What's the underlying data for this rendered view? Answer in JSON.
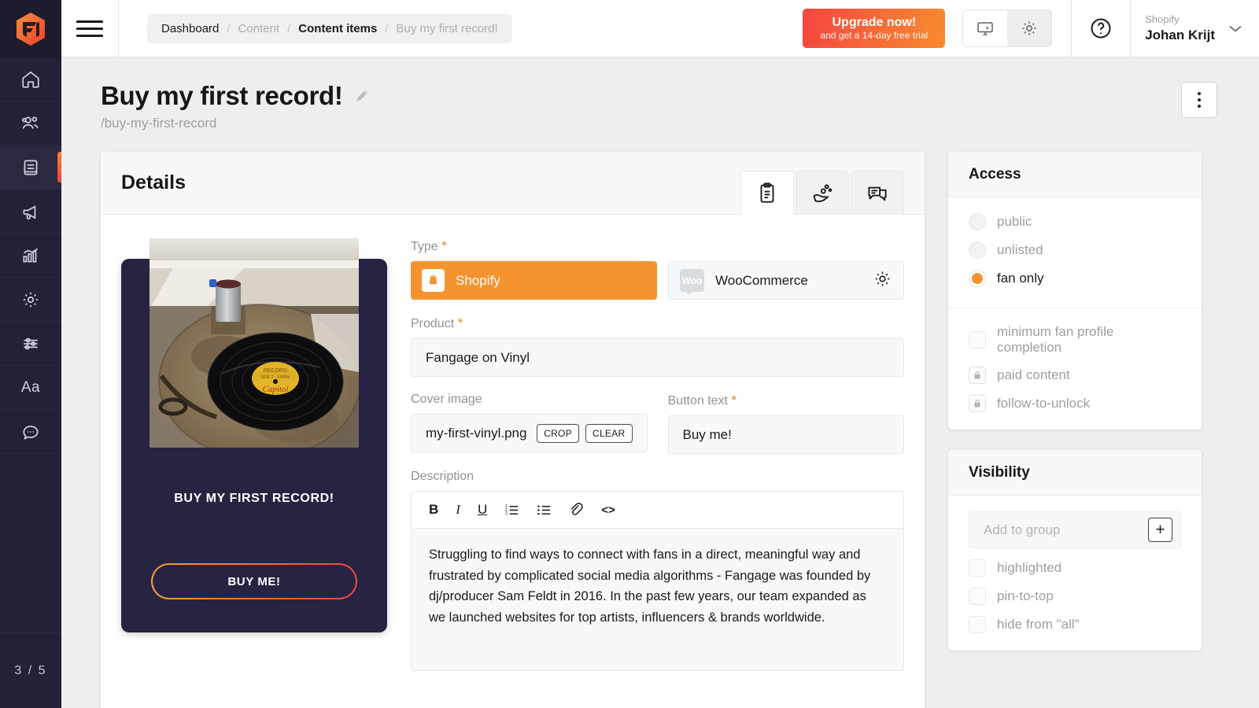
{
  "rail": {
    "logo_icon": "fangage-hex-logo",
    "items": [
      {
        "icon": "home-icon",
        "name": "home"
      },
      {
        "icon": "users-icon",
        "name": "fans"
      },
      {
        "icon": "book-icon",
        "name": "content",
        "active": true
      },
      {
        "icon": "megaphone-icon",
        "name": "campaigns"
      },
      {
        "icon": "bar-chart-icon",
        "name": "analytics"
      },
      {
        "icon": "gear-icon",
        "name": "settings"
      },
      {
        "icon": "sliders-icon",
        "name": "preferences"
      },
      {
        "icon": "typography-icon",
        "name": "typography",
        "glyph": "Aa"
      },
      {
        "icon": "chat-bubble-icon",
        "name": "messages"
      }
    ],
    "page_indicator": "3 / 5"
  },
  "topbar": {
    "menu_icon": "hamburger-icon",
    "breadcrumb": [
      {
        "label": "Dashboard",
        "style": "link"
      },
      {
        "label": "Content",
        "style": "muted"
      },
      {
        "label": "Content items",
        "style": "bold"
      },
      {
        "label": "Buy my first record!",
        "style": "muted"
      }
    ],
    "separator": "/",
    "upgrade": {
      "line1": "Upgrade now!",
      "line2": "and get a 14-day free trial",
      "gradient_from": "#f6473f",
      "gradient_to": "#f78a2e"
    },
    "segment": [
      {
        "icon": "monitor-cursor-icon",
        "active": false
      },
      {
        "icon": "gear-icon",
        "active": true
      }
    ],
    "help_icon": "question-circle-icon",
    "user": {
      "org": "Shopify",
      "name": "Johan Krijt",
      "chevron_icon": "chevron-down-icon"
    }
  },
  "page": {
    "title": "Buy my first record!",
    "edit_icon": "pencil-icon",
    "slug": "/buy-my-first-record",
    "kebab_icon": "more-vertical-icon"
  },
  "details": {
    "title": "Details",
    "tabs": [
      {
        "icon": "clipboard-icon",
        "name": "details-tab",
        "active": true
      },
      {
        "icon": "hand-bubbles-icon",
        "name": "engagement-tab",
        "active": false
      },
      {
        "icon": "speech-bubbles-icon",
        "name": "comments-tab",
        "active": false
      }
    ],
    "preview": {
      "title": "BUY MY FIRST RECORD!",
      "button_label": "BUY ME!",
      "image_alt": "vinyl-record-on-table",
      "bg_color": "#262442",
      "button_gradient_from": "#f6a13a",
      "button_gradient_to": "#f0443c"
    },
    "form": {
      "type": {
        "label": "Type",
        "required": "*",
        "options": [
          {
            "label": "Shopify",
            "icon": "shopify-bag-icon",
            "selected": true
          },
          {
            "label": "WooCommerce",
            "icon": "woo-badge-icon",
            "selected": false,
            "gear_icon": "gear-icon"
          }
        ]
      },
      "product": {
        "label": "Product",
        "required": "*",
        "value": "Fangage on Vinyl"
      },
      "cover_image": {
        "label": "Cover image",
        "value": "my-first-vinyl.png",
        "crop_label": "CROP",
        "clear_label": "CLEAR"
      },
      "button_text": {
        "label": "Button text",
        "required": "*",
        "value": "Buy me!"
      },
      "description": {
        "label": "Description",
        "toolbar": [
          {
            "glyph": "B",
            "name": "bold-icon"
          },
          {
            "glyph": "I",
            "name": "italic-icon"
          },
          {
            "glyph": "U",
            "name": "underline-icon"
          },
          {
            "glyph": "",
            "name": "ordered-list-icon"
          },
          {
            "glyph": "",
            "name": "bullet-list-icon"
          },
          {
            "glyph": "",
            "name": "link-icon"
          },
          {
            "glyph": "<>",
            "name": "code-icon"
          }
        ],
        "value": "Struggling to find ways to connect with fans in a direct, meaningful way and frustrated by complicated social media algorithms - Fangage was founded by dj/producer Sam Feldt in 2016. In the past few years, our team expanded as we launched websites for top artists, influencers & brands worldwide."
      }
    }
  },
  "access": {
    "title": "Access",
    "radios": [
      {
        "label": "public",
        "selected": false
      },
      {
        "label": "unlisted",
        "selected": false
      },
      {
        "label": "fan only",
        "selected": true
      }
    ],
    "accent_color": "#f5942f",
    "checks": [
      {
        "label": "minimum fan profile completion",
        "type": "checkbox",
        "checked": false
      },
      {
        "label": "paid content",
        "type": "locked",
        "icon": "lock-icon"
      },
      {
        "label": "follow-to-unlock",
        "type": "locked",
        "icon": "lock-icon"
      }
    ]
  },
  "visibility": {
    "title": "Visibility",
    "group_placeholder": "Add to group",
    "add_icon": "plus-icon",
    "checks": [
      {
        "label": "highlighted",
        "checked": false
      },
      {
        "label": "pin-to-top",
        "checked": false
      },
      {
        "label": "hide from \"all\"",
        "checked": false
      }
    ]
  }
}
